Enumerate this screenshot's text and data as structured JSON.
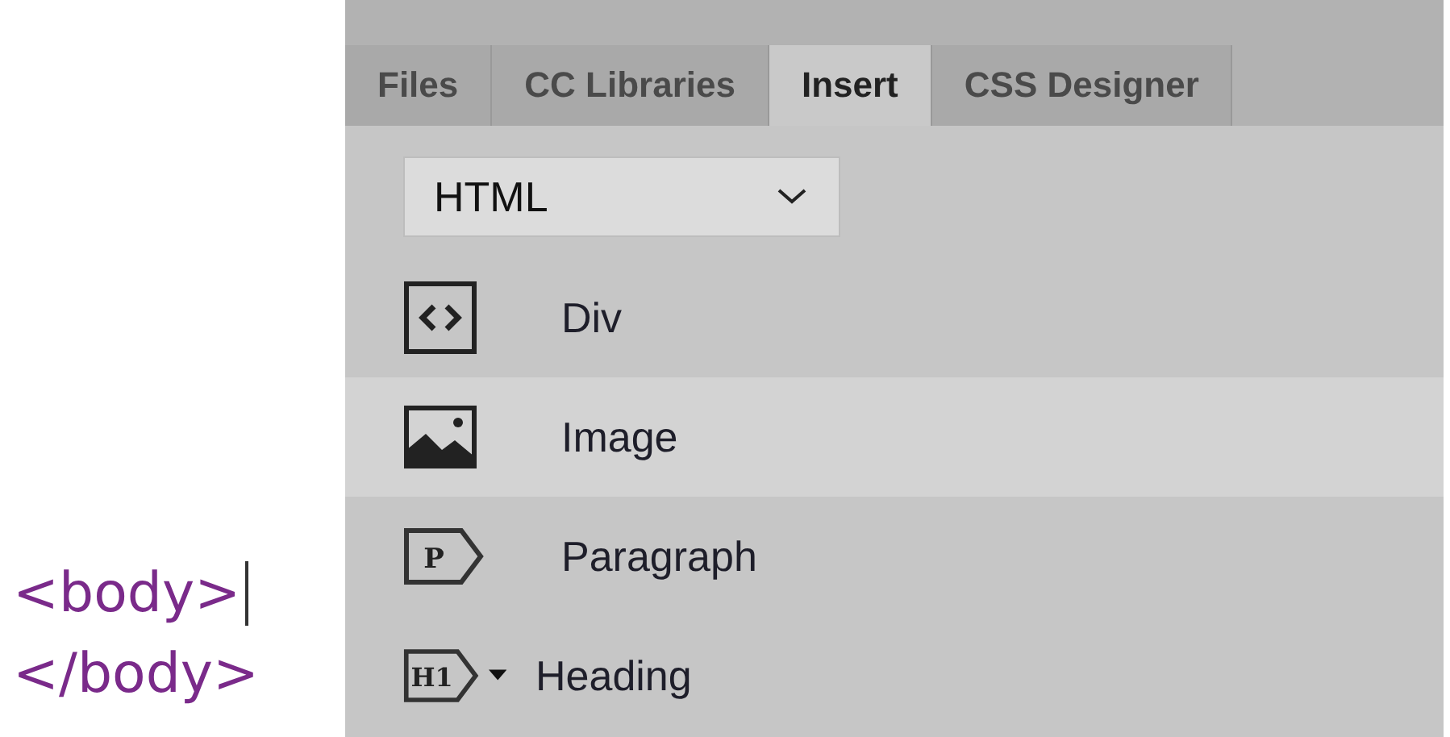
{
  "code_lines": [
    {
      "text": "<body>",
      "cursor": true
    },
    {
      "text": "</body>",
      "cursor": false
    }
  ],
  "tabs": [
    {
      "label": "Files",
      "selected": false
    },
    {
      "label": "CC Libraries",
      "selected": false
    },
    {
      "label": "Insert",
      "selected": true
    },
    {
      "label": "CSS Designer",
      "selected": false
    }
  ],
  "category_select": {
    "value": "HTML"
  },
  "items": [
    {
      "label": "Div",
      "kind": "div",
      "selected": false,
      "has_menu": false
    },
    {
      "label": "Image",
      "kind": "image",
      "selected": true,
      "has_menu": false
    },
    {
      "label": "Paragraph",
      "kind": "tag",
      "tag_label": "P",
      "selected": false,
      "has_menu": false
    },
    {
      "label": "Heading",
      "kind": "tag",
      "tag_label": "H1",
      "selected": false,
      "has_menu": true
    }
  ]
}
